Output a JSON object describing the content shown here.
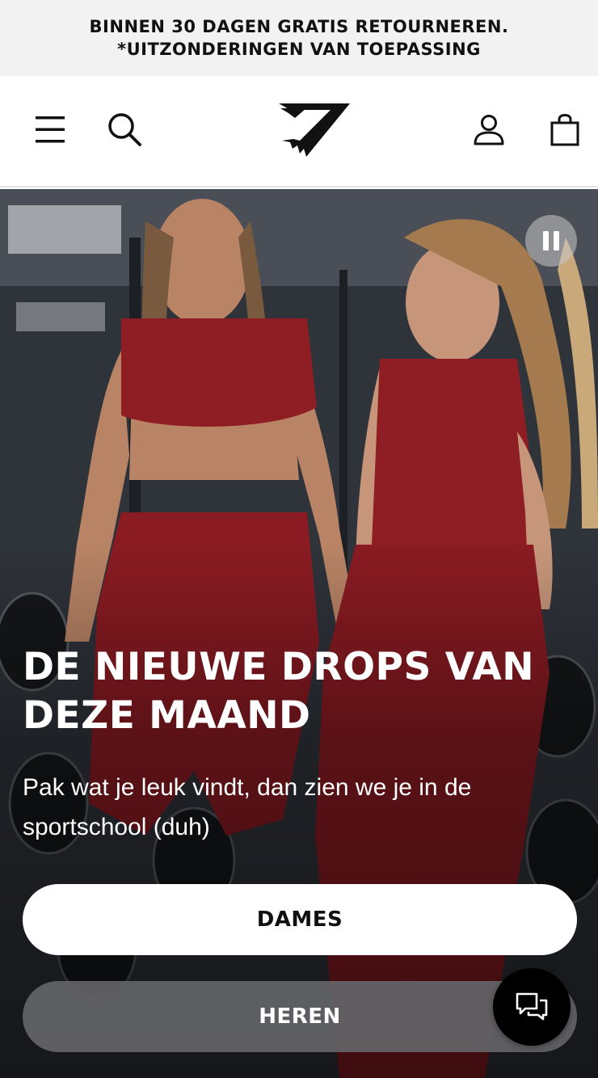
{
  "announcement": {
    "line1": "BINNEN 30 DAGEN GRATIS RETOURNEREN.",
    "line2": "*UITZONDERINGEN VAN TOEPASSING"
  },
  "header": {
    "icons": [
      "menu-icon",
      "search-icon",
      "brand-logo",
      "account-icon",
      "shopping-bag-icon"
    ]
  },
  "hero": {
    "title": "DE NIEUWE DROPS VAN DEZE MAAND",
    "subtitle": "Pak wat je leuk vindt, dan zien we je in de sportschool (duh)",
    "pause_icon": "pause-icon",
    "buttons": {
      "women": "DAMES",
      "men": "HEREN"
    }
  },
  "chat": {
    "icon": "chat-bubbles-icon"
  },
  "colors": {
    "accent_red": "#8f1d24",
    "text_dark": "#111111",
    "banner_bg": "#f2f2f2"
  }
}
